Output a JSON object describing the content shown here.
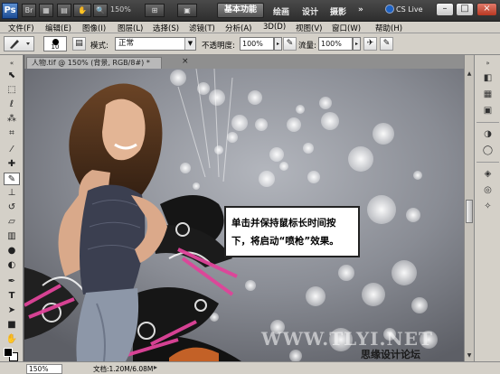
{
  "titlebar": {
    "logo": "Ps",
    "zoom": "150%",
    "workspace_active": "基本功能",
    "workspaces": [
      "绘画",
      "设计",
      "摄影"
    ],
    "more": "»",
    "cs_live": "CS Live",
    "min": "–",
    "max": "□",
    "close": "×"
  },
  "menu": [
    "文件(F)",
    "编辑(E)",
    "图像(I)",
    "图层(L)",
    "选择(S)",
    "滤镜(T)",
    "分析(A)",
    "3D(D)",
    "视图(V)",
    "窗口(W)",
    "帮助(H)"
  ],
  "options": {
    "brush_size": "10",
    "mode_label": "模式:",
    "mode_value": "正常",
    "opacity_label": "不透明度:",
    "opacity_value": "100%",
    "flow_label": "流量:",
    "flow_value": "100%"
  },
  "document": {
    "tab_title": "人物.tif @ 150% (背景, RGB/8#) *",
    "tab_close": "×"
  },
  "callout": {
    "line1": "单击并保持鼠标长时间按",
    "line2": "下，将启动“喷枪”效果。"
  },
  "watermark": "WWW.TLYI.NET",
  "watermark2": "思缘设计论坛",
  "status": {
    "zoom": "150%",
    "doc_info": "文档:1.20M/6.08M"
  },
  "icons": {
    "tools": [
      "move-icon",
      "marquee-icon",
      "lasso-icon",
      "quick-select-icon",
      "crop-icon",
      "eyedropper-icon",
      "healing-brush-icon",
      "brush-icon",
      "clone-stamp-icon",
      "history-brush-icon",
      "eraser-icon",
      "gradient-icon",
      "blur-icon",
      "dodge-icon",
      "pen-icon",
      "type-icon",
      "path-select-icon",
      "shape-icon",
      "hand-icon",
      "zoom-icon"
    ],
    "dock": [
      "color-panel-icon",
      "swatches-panel-icon",
      "styles-panel-icon",
      "adjustments-panel-icon",
      "masks-panel-icon",
      "layers-panel-icon",
      "channels-panel-icon",
      "paths-panel-icon"
    ]
  },
  "colors": {
    "accent": "#1e63c4",
    "close_red": "#c0412a",
    "pink": "#e0449a"
  }
}
